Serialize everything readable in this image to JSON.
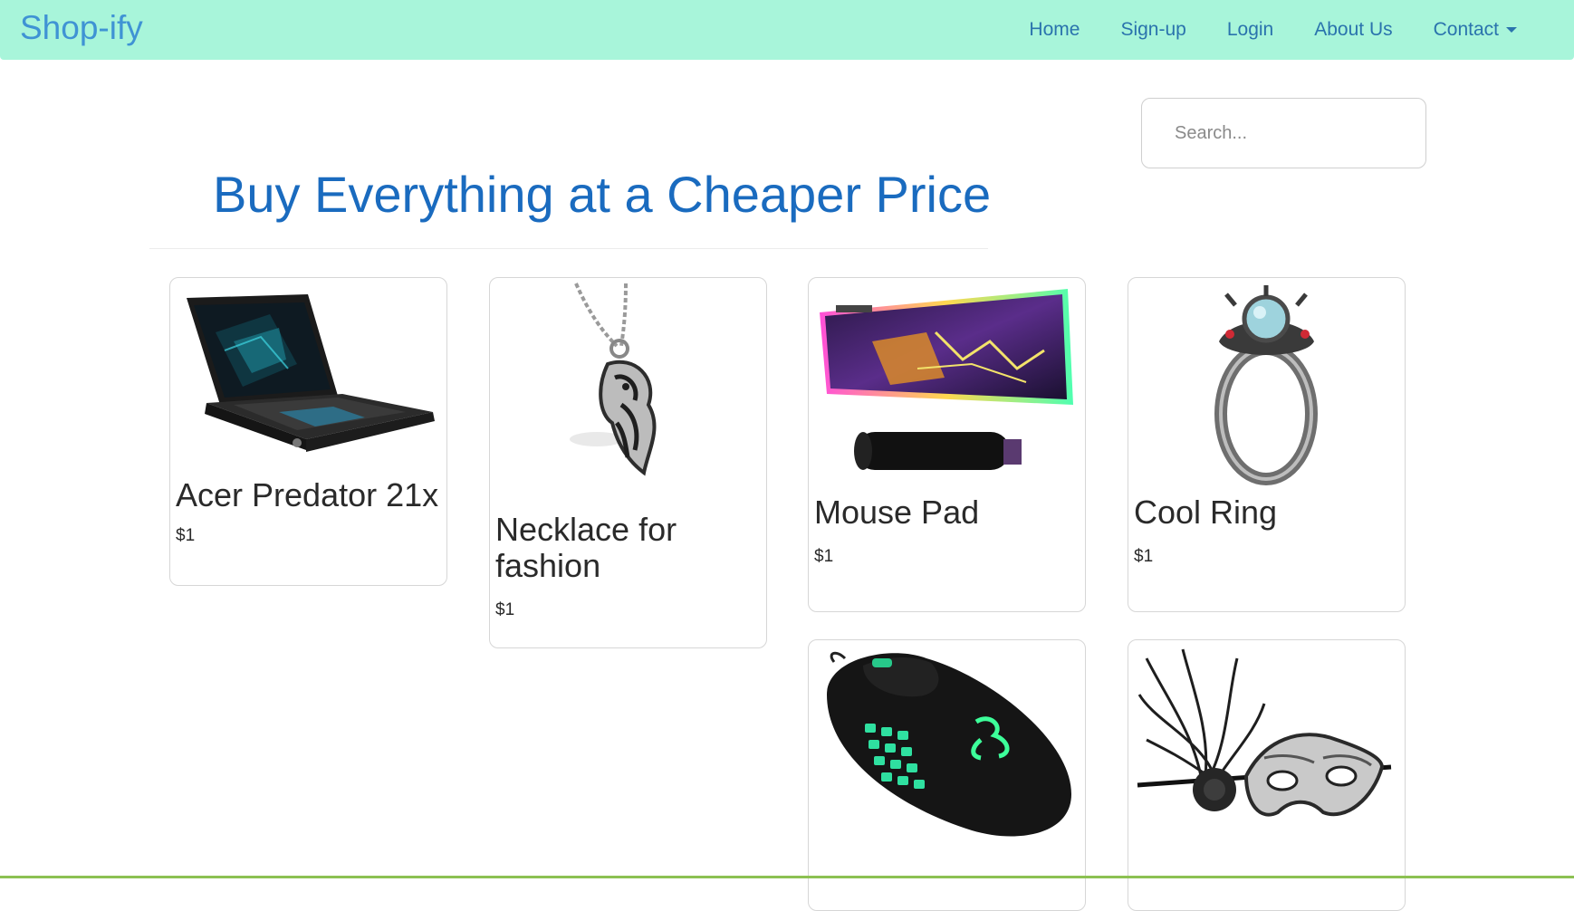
{
  "navbar": {
    "brand": "Shop-ify",
    "links": [
      "Home",
      "Sign-up",
      "Login",
      "About Us"
    ],
    "dropdown_label": "Contact",
    "background": "#a8f5da",
    "link_color": "#2a73ad"
  },
  "search": {
    "placeholder": "Search..."
  },
  "hero": {
    "title": "Buy Everything at a Cheaper Price",
    "color": "#1a6bbf"
  },
  "products": [
    {
      "name": "Acer Predator 21x",
      "price": "$1",
      "image": "laptop"
    },
    {
      "name": "Necklace for fashion",
      "price": "$1",
      "image": "dragon-necklace"
    },
    {
      "name": "Mouse Pad",
      "price": "$1",
      "image": "rgb-mouse-pad"
    },
    {
      "name": "Cool Ring",
      "price": "$1",
      "image": "gemstone-ring"
    },
    {
      "name": "",
      "price": "",
      "image": "gaming-mouse"
    },
    {
      "name": "",
      "price": "",
      "image": "masquerade-mask"
    }
  ]
}
